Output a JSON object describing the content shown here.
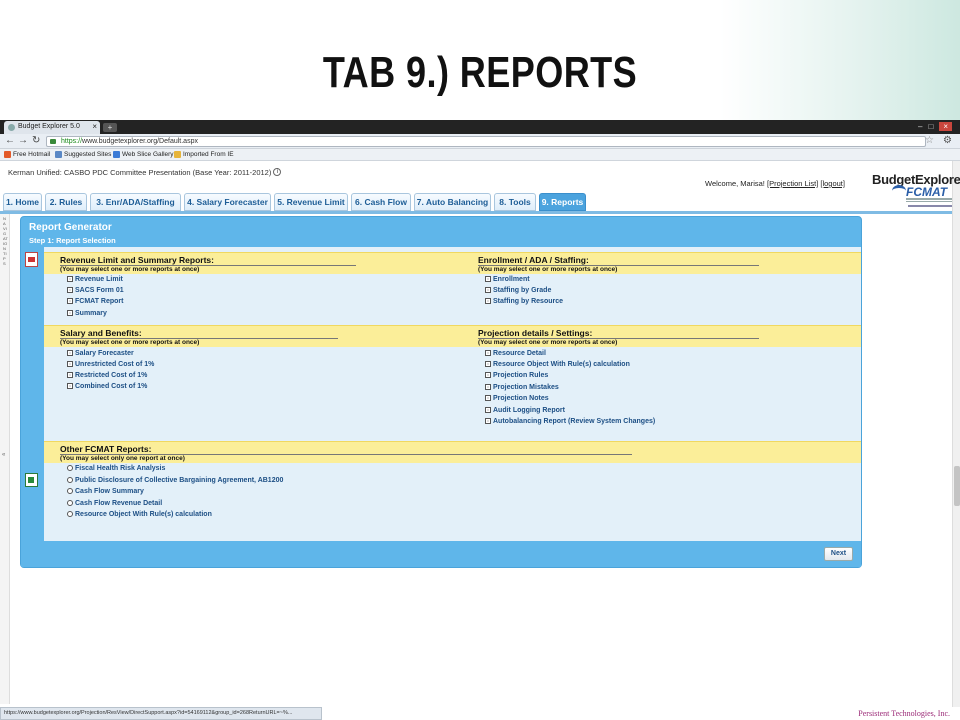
{
  "slide": {
    "title": "TAB 9.) REPORTS",
    "company": "Persistent Technologies, Inc."
  },
  "browser": {
    "tab_title": "Budget Explorer 5.0",
    "new_tab_label": "+",
    "url_scheme": "https://",
    "url_rest": "www.budgetexplorer.org/Default.aspx",
    "bookmarks": [
      {
        "label": "Free Hotmail",
        "color": "#e35b2a"
      },
      {
        "label": "Suggested Sites",
        "color": "#5a88c5"
      },
      {
        "label": "Web Slice Gallery",
        "color": "#3b7bd6"
      },
      {
        "label": "Imported From IE",
        "color": "#e6b43a"
      }
    ],
    "status_url": "https://www.budgetexplorer.org/Projection/ResView/DirectSupport.aspx?id=54169112&group_id=268ReturnURL=~%..."
  },
  "header": {
    "context": "Kerman Unified: CASBO PDC Committee Presentation (Base Year: 2011-2012)",
    "welcome": "Welcome, Marisa!",
    "projection_list": "[Projection List]",
    "logout": "[logout]",
    "logo_text": "BudgetExplorer",
    "logo_sub": "FCMAT"
  },
  "nav": {
    "strip_text": "NAVIGATION TIPS",
    "tabs": [
      "1. Home",
      "2. Rules",
      "3. Enr/ADA/Staffing",
      "4. Salary Forecaster",
      "5. Revenue Limit",
      "6. Cash Flow",
      "7. Auto Balancing",
      "8. Tools",
      "9. Reports"
    ]
  },
  "report": {
    "title": "Report Generator",
    "step": "Step 1: Report Selection",
    "multi_note": "(You may select one or more reports at once)",
    "single_note": "(You may select only one report at once)",
    "revenue_summary": {
      "heading": "Revenue Limit and Summary Reports:",
      "items": [
        "Revenue Limit",
        "SACS Form 01",
        "FCMAT Report",
        "Summary"
      ]
    },
    "enrollment": {
      "heading": "Enrollment / ADA / Staffing:",
      "items": [
        "Enrollment",
        "Staffing by Grade",
        "Staffing by Resource"
      ]
    },
    "salary": {
      "heading": "Salary and Benefits:",
      "items": [
        "Salary Forecaster",
        "Unrestricted Cost of 1%",
        "Restricted Cost of 1%",
        "Combined Cost of 1%"
      ]
    },
    "projection": {
      "heading": "Projection details / Settings:",
      "items": [
        "Resource Detail",
        "Resource Object With Rule(s) calculation",
        "Projection Rules",
        "Projection Mistakes",
        "Projection Notes",
        "Audit Logging Report",
        "Autobalancing Report (Review System Changes)"
      ]
    },
    "other": {
      "heading": "Other FCMAT Reports:",
      "items": [
        "Fiscal Health Risk Analysis",
        "Public Disclosure of Collective Bargaining Agreement, AB1200",
        "Cash Flow Summary",
        "Cash Flow Revenue Detail",
        "Resource Object With Rule(s) calculation"
      ]
    },
    "next_label": "Next"
  }
}
